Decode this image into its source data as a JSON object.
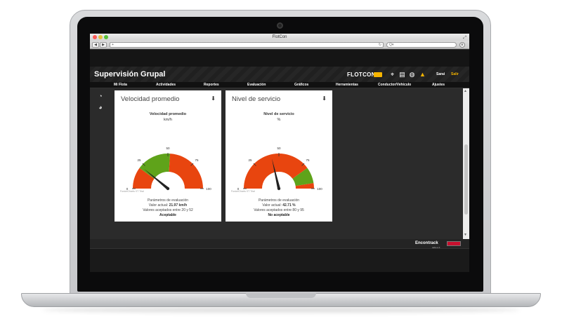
{
  "browser": {
    "window_title": "FlotCon",
    "back_label": "◀",
    "forward_label": "▶",
    "new_tab_label": "+",
    "url_value": "",
    "reload_icon": "reload-icon",
    "search_placeholder": "Q▾"
  },
  "header": {
    "title": "Supervisión Grupal",
    "brand": "FLOTCON",
    "user": "Sarai",
    "logout_label": "Salir",
    "icons": [
      "map-pin-icon",
      "document-icon",
      "globe-icon",
      "bell-icon"
    ]
  },
  "menu": {
    "items": [
      "Mi Flota",
      "Actividades",
      "Reportes",
      "Evaluación",
      "Gráficos",
      "Herramientas",
      "Conductor/Vehículo",
      "Ajustes"
    ]
  },
  "sidebar": {
    "icons": [
      "pie-chart-icon",
      "gauge-icon"
    ]
  },
  "gauges": [
    {
      "card_title": "Velocidad promedio",
      "chart_title": "Velocidad promedio",
      "unit": "km/h",
      "credits": "FusionCharts XT Trial",
      "params_label": "Parámetros de evaluación",
      "current_label": "Valor actual:",
      "current_value": "21.97 km/h",
      "accepted_text": "Valores aceptados entre 20 y 52",
      "status": "Aceptable"
    },
    {
      "card_title": "Nivel de servicio",
      "chart_title": "Nivel de servicio",
      "unit": "%",
      "credits": "FusionCharts XT Trial",
      "params_label": "Parámetros de evaluación",
      "current_label": "Valor actual:",
      "current_value": "42.71 %",
      "accepted_text": "Valores aceptados entre 80 y 95",
      "status": "No aceptable"
    }
  ],
  "chart_data": [
    {
      "type": "gauge",
      "title": "Velocidad promedio",
      "unit": "km/h",
      "range": [
        0,
        100
      ],
      "tick_labels": [
        "0",
        "25",
        "50",
        "75",
        "100"
      ],
      "bands": [
        {
          "from": 0,
          "to": 20,
          "color": "#e8450f"
        },
        {
          "from": 20,
          "to": 52,
          "color": "#5fa31a"
        },
        {
          "from": 52,
          "to": 100,
          "color": "#e8450f"
        }
      ],
      "value": 21.97
    },
    {
      "type": "gauge",
      "title": "Nivel de servicio",
      "unit": "%",
      "range": [
        0,
        100
      ],
      "tick_labels": [
        "0",
        "25",
        "50",
        "75",
        "100"
      ],
      "bands": [
        {
          "from": 0,
          "to": 80,
          "color": "#e8450f"
        },
        {
          "from": 80,
          "to": 95,
          "color": "#5fa31a"
        },
        {
          "from": 95,
          "to": 100,
          "color": "#e8450f"
        }
      ],
      "value": 42.71
    }
  ],
  "footer": {
    "logo": "Encontrack",
    "slogan": "sabe a ti",
    "colors": {
      "accent": "#f5b400",
      "danger": "#e8450f",
      "ok": "#5fa31a"
    }
  }
}
